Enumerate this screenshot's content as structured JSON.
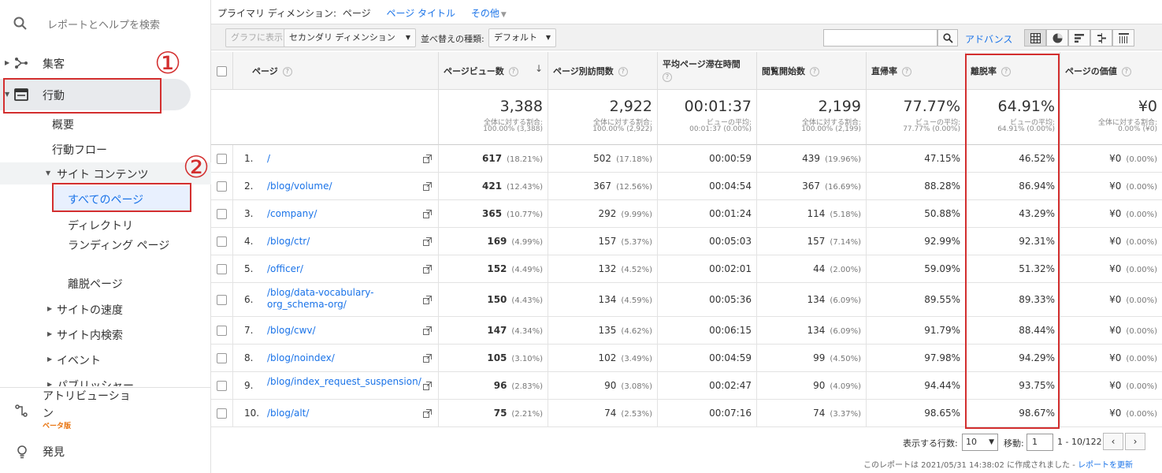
{
  "sidebar": {
    "search_placeholder": "レポートとヘルプを検索",
    "acquisition": "集客",
    "behavior": "行動",
    "overview": "概要",
    "behavior_flow": "行動フロー",
    "site_content": "サイト コンテンツ",
    "all_pages": "すべてのページ",
    "directory": "ディレクトリ",
    "landing_pages": "ランディング ページ",
    "exit_pages": "離脱ページ",
    "site_speed": "サイトの速度",
    "site_search": "サイト内検索",
    "events": "イベント",
    "publisher": "パブリッシャー",
    "attribution": "アトリビューション",
    "beta": "ベータ版",
    "discover": "発見"
  },
  "annotations": {
    "step1": "①",
    "step2": "②",
    "highlight_color": "#d32f2f"
  },
  "dimension_bar": {
    "label": "プライマリ ディメンション:",
    "selected": "ページ",
    "page_title": "ページ タイトル",
    "other": "その他"
  },
  "toolbar": {
    "graph_btn": "グラフに表示",
    "secondary_dim": "セカンダリ ディメンション",
    "sort_label": "並べ替えの種類:",
    "sort_value": "デフォルト",
    "search_value": "",
    "advanced": "アドバンス"
  },
  "table": {
    "headers": {
      "page": "ページ",
      "pageviews": "ページビュー数",
      "unique_pageviews": "ページ別訪問数",
      "avg_time_1": "平均ページ滞在時間",
      "entrances": "閲覧開始数",
      "bounce_rate": "直帰率",
      "exit_rate": "離脱率",
      "page_value": "ページの価値"
    },
    "totals": {
      "pageviews": {
        "big": "3,388",
        "s1": "全体に対する割合:",
        "s2": "100.00% (3,388)"
      },
      "unique_pageviews": {
        "big": "2,922",
        "s1": "全体に対する割合:",
        "s2": "100.00% (2,922)"
      },
      "avg_time": {
        "big": "00:01:37",
        "s1": "ビューの平均:",
        "s2": "00:01:37 (0.00%)"
      },
      "entrances": {
        "big": "2,199",
        "s1": "全体に対する割合:",
        "s2": "100.00% (2,199)"
      },
      "bounce_rate": {
        "big": "77.77%",
        "s1": "ビューの平均:",
        "s2": "77.77% (0.00%)"
      },
      "exit_rate": {
        "big": "64.91%",
        "s1": "ビューの平均:",
        "s2": "64.91% (0.00%)"
      },
      "page_value": {
        "big": "¥0",
        "s1": "全体に対する割合:",
        "s2": "0.00% (¥0)"
      }
    },
    "rows": [
      {
        "n": "1.",
        "page": "/",
        "pv": "617",
        "pv_pct": "(18.21%)",
        "upv": "502",
        "upv_pct": "(17.18%)",
        "time": "00:00:59",
        "ent": "439",
        "ent_pct": "(19.96%)",
        "bounce": "47.15%",
        "exit": "46.52%",
        "val": "¥0",
        "val_pct": "(0.00%)"
      },
      {
        "n": "2.",
        "page": "/blog/volume/",
        "pv": "421",
        "pv_pct": "(12.43%)",
        "upv": "367",
        "upv_pct": "(12.56%)",
        "time": "00:04:54",
        "ent": "367",
        "ent_pct": "(16.69%)",
        "bounce": "88.28%",
        "exit": "86.94%",
        "val": "¥0",
        "val_pct": "(0.00%)"
      },
      {
        "n": "3.",
        "page": "/company/",
        "pv": "365",
        "pv_pct": "(10.77%)",
        "upv": "292",
        "upv_pct": "(9.99%)",
        "time": "00:01:24",
        "ent": "114",
        "ent_pct": "(5.18%)",
        "bounce": "50.88%",
        "exit": "43.29%",
        "val": "¥0",
        "val_pct": "(0.00%)"
      },
      {
        "n": "4.",
        "page": "/blog/ctr/",
        "pv": "169",
        "pv_pct": "(4.99%)",
        "upv": "157",
        "upv_pct": "(5.37%)",
        "time": "00:05:03",
        "ent": "157",
        "ent_pct": "(7.14%)",
        "bounce": "92.99%",
        "exit": "92.31%",
        "val": "¥0",
        "val_pct": "(0.00%)"
      },
      {
        "n": "5.",
        "page": "/officer/",
        "pv": "152",
        "pv_pct": "(4.49%)",
        "upv": "132",
        "upv_pct": "(4.52%)",
        "time": "00:02:01",
        "ent": "44",
        "ent_pct": "(2.00%)",
        "bounce": "59.09%",
        "exit": "51.32%",
        "val": "¥0",
        "val_pct": "(0.00%)"
      },
      {
        "n": "6.",
        "page": "/blog/data-vocabulary-org_schema-org/",
        "pv": "150",
        "pv_pct": "(4.43%)",
        "upv": "134",
        "upv_pct": "(4.59%)",
        "time": "00:05:36",
        "ent": "134",
        "ent_pct": "(6.09%)",
        "bounce": "89.55%",
        "exit": "89.33%",
        "val": "¥0",
        "val_pct": "(0.00%)"
      },
      {
        "n": "7.",
        "page": "/blog/cwv/",
        "pv": "147",
        "pv_pct": "(4.34%)",
        "upv": "135",
        "upv_pct": "(4.62%)",
        "time": "00:06:15",
        "ent": "134",
        "ent_pct": "(6.09%)",
        "bounce": "91.79%",
        "exit": "88.44%",
        "val": "¥0",
        "val_pct": "(0.00%)"
      },
      {
        "n": "8.",
        "page": "/blog/noindex/",
        "pv": "105",
        "pv_pct": "(3.10%)",
        "upv": "102",
        "upv_pct": "(3.49%)",
        "time": "00:04:59",
        "ent": "99",
        "ent_pct": "(4.50%)",
        "bounce": "97.98%",
        "exit": "94.29%",
        "val": "¥0",
        "val_pct": "(0.00%)"
      },
      {
        "n": "9.",
        "page": "/blog/index_request_suspension/",
        "pv": "96",
        "pv_pct": "(2.83%)",
        "upv": "90",
        "upv_pct": "(3.08%)",
        "time": "00:02:47",
        "ent": "90",
        "ent_pct": "(4.09%)",
        "bounce": "94.44%",
        "exit": "93.75%",
        "val": "¥0",
        "val_pct": "(0.00%)"
      },
      {
        "n": "10.",
        "page": "/blog/alt/",
        "pv": "75",
        "pv_pct": "(2.21%)",
        "upv": "74",
        "upv_pct": "(2.53%)",
        "time": "00:07:16",
        "ent": "74",
        "ent_pct": "(3.37%)",
        "bounce": "98.65%",
        "exit": "98.67%",
        "val": "¥0",
        "val_pct": "(0.00%)"
      }
    ]
  },
  "pager": {
    "rows_label": "表示する行数:",
    "rows_value": "10",
    "goto_label": "移動:",
    "goto_value": "1",
    "range": "1 - 10/122",
    "prev": "‹",
    "next": "›"
  },
  "footer": {
    "note": "このレポートは 2021/05/31 14:38:02 に作成されました - ",
    "refresh": "レポートを更新"
  }
}
